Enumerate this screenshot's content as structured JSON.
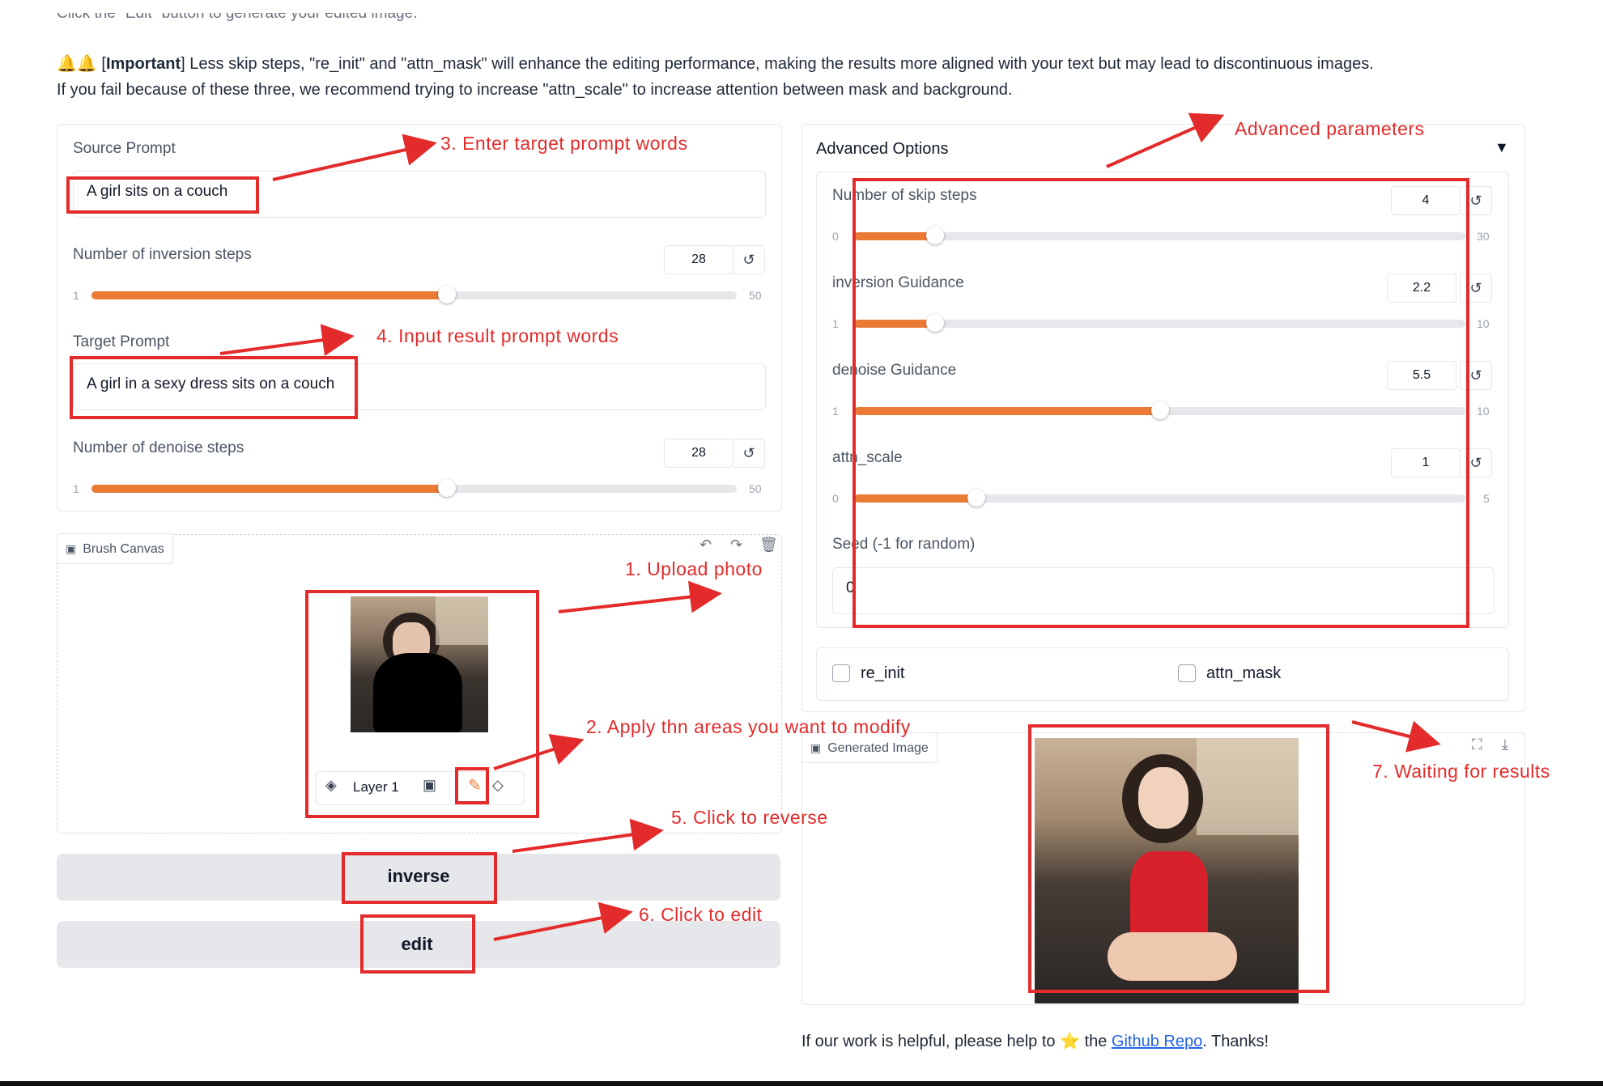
{
  "intro": {
    "top_line": "Click the \"Edit\" button to generate your edited image.",
    "emoji": "🔔🔔",
    "important_label": "Important",
    "important_rest": "Less skip steps, \"re_init\" and \"attn_mask\" will enhance the editing performance, making the results more aligned with your text but may lead to discontinuous images.",
    "second_line": "If you fail because of these three, we recommend trying to increase \"attn_scale\" to increase attention between mask and background."
  },
  "left_panel": {
    "source_prompt_label": "Source Prompt",
    "source_prompt_value": "A girl sits on a couch",
    "inversion_steps": {
      "label": "Number of inversion steps",
      "value": "28",
      "min": "1",
      "max": "50",
      "fraction": 0.551
    },
    "target_prompt_label": "Target Prompt",
    "target_prompt_value": "A girl in a sexy dress sits on a couch",
    "denoise_steps": {
      "label": "Number of denoise steps",
      "value": "28",
      "min": "1",
      "max": "50",
      "fraction": 0.551
    }
  },
  "canvas": {
    "label": "Brush Canvas",
    "layer_label": "Layer 1"
  },
  "buttons": {
    "inverse": "inverse",
    "edit": "edit"
  },
  "advanced": {
    "title": "Advanced Options",
    "toggle_icon": "▼",
    "sliders": [
      {
        "label": "Number of skip steps",
        "value": "4",
        "min": "0",
        "max": "30",
        "fraction": 0.133
      },
      {
        "label": "inversion Guidance",
        "value": "2.2",
        "min": "1",
        "max": "10",
        "fraction": 0.133
      },
      {
        "label": "denoise Guidance",
        "value": "5.5",
        "min": "1",
        "max": "10",
        "fraction": 0.5
      },
      {
        "label": "attn_scale",
        "value": "1",
        "min": "0",
        "max": "5",
        "fraction": 0.2
      }
    ],
    "seed_label": "Seed (-1 for random)",
    "seed_value": "0",
    "checkbox_re_init": "re_init",
    "checkbox_attn_mask": "attn_mask"
  },
  "output": {
    "label": "Generated Image"
  },
  "footer": {
    "prefix": "If our work is helpful, please help to",
    "star": "⭐",
    "the": "the",
    "link": "Github Repo",
    "suffix": ". Thanks!"
  },
  "annotations": {
    "a1": "1. Upload photo",
    "a2": "2. Apply thn areas you want to modify",
    "a3": "3. Enter target prompt words",
    "a4": "4. Input result prompt words",
    "a5": "5. Click to reverse",
    "a6": "6. Click to edit",
    "a7": "7. Waiting for results",
    "adv": "Advanced parameters"
  },
  "colors": {
    "accent": "#ea7a34",
    "annotation": "#e32b2b",
    "link": "#2563eb"
  }
}
